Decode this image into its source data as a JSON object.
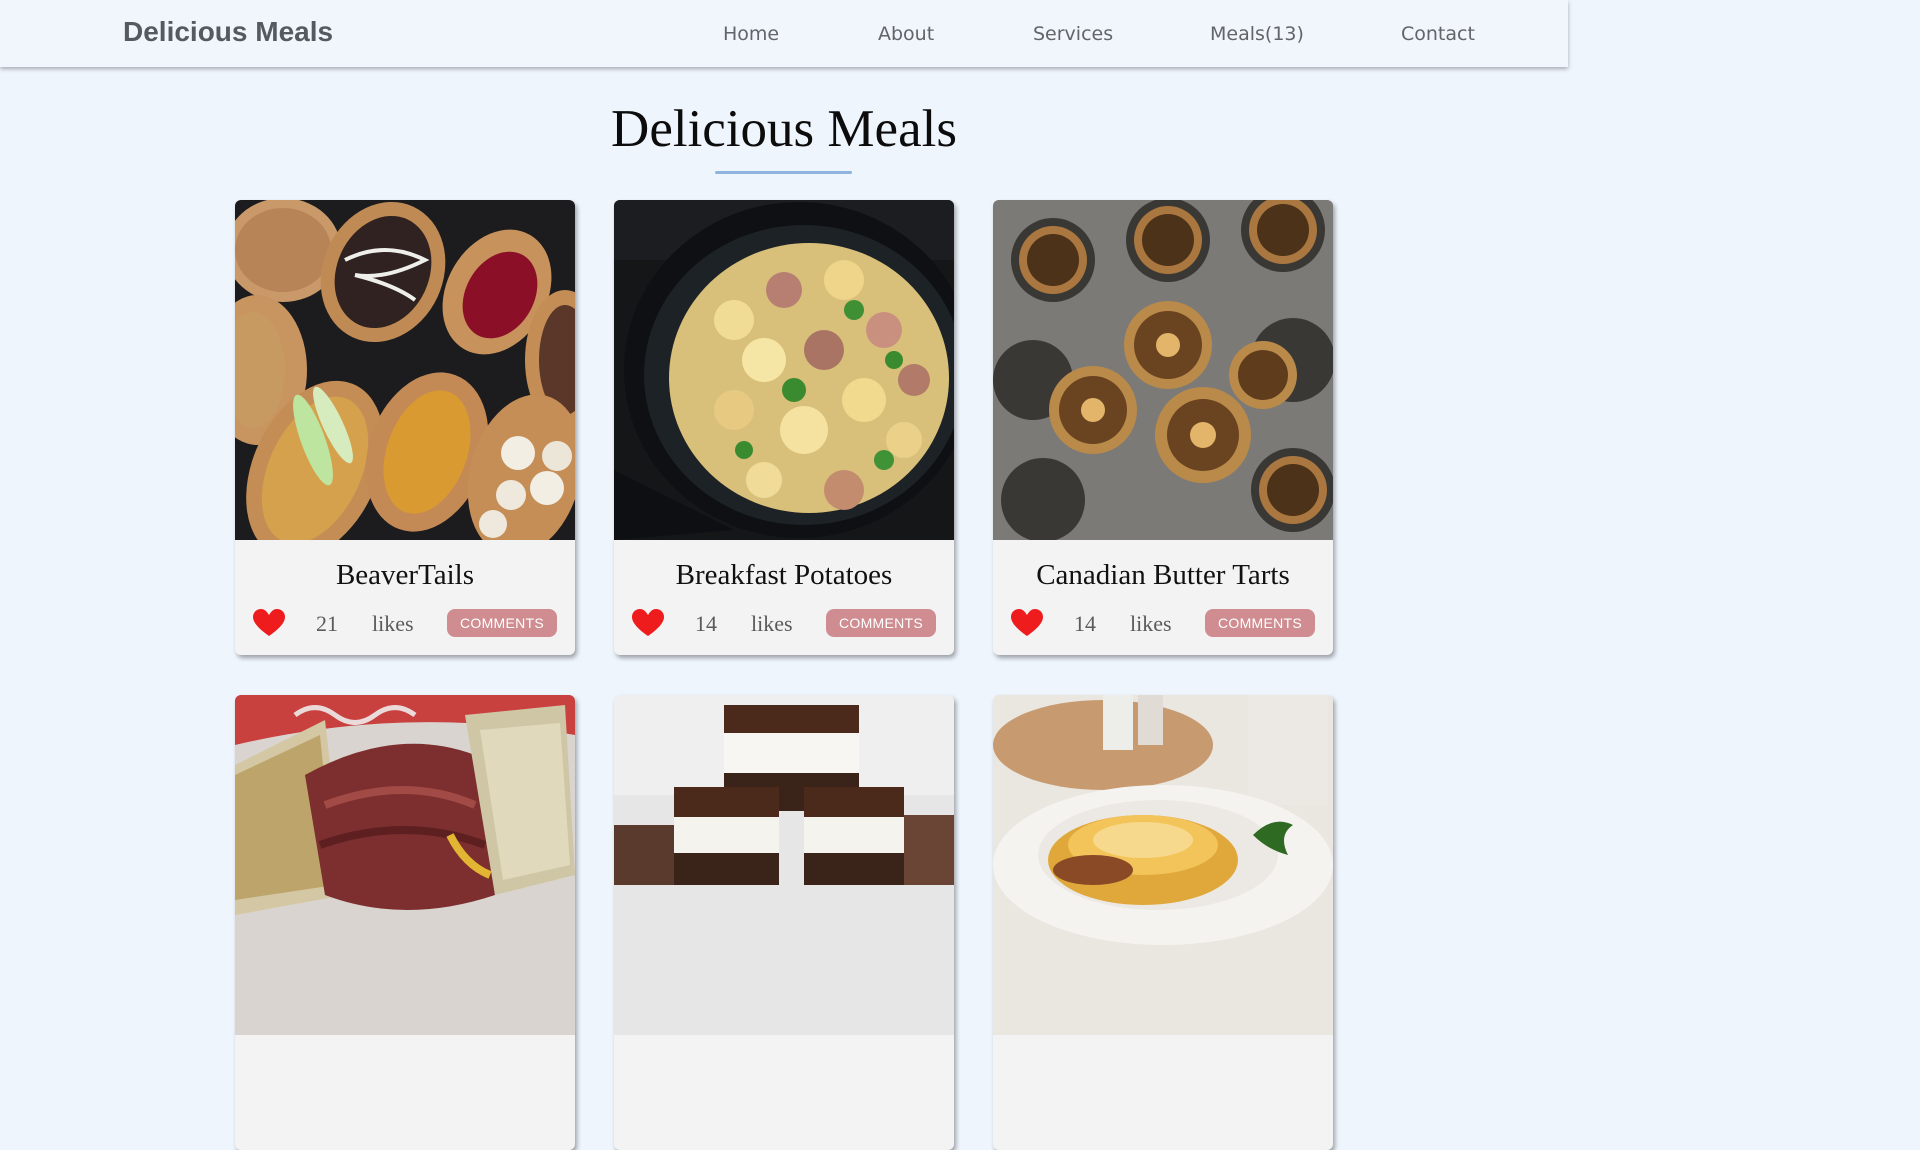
{
  "nav": {
    "brand": "Delicious Meals",
    "links": [
      "Home",
      "About",
      "Services",
      "Meals(13)",
      "Contact"
    ]
  },
  "page": {
    "title": "Delicious Meals"
  },
  "meals": [
    {
      "name": "BeaverTails",
      "likes": "21",
      "likes_label": "likes",
      "comments_label": "COMMENTS"
    },
    {
      "name": "Breakfast Potatoes",
      "likes": "14",
      "likes_label": "likes",
      "comments_label": "COMMENTS"
    },
    {
      "name": "Canadian Butter Tarts",
      "likes": "14",
      "likes_label": "likes",
      "comments_label": "COMMENTS"
    },
    {
      "name": "",
      "likes": "",
      "likes_label": "",
      "comments_label": ""
    },
    {
      "name": "",
      "likes": "",
      "likes_label": "",
      "comments_label": ""
    },
    {
      "name": "",
      "likes": "",
      "likes_label": "",
      "comments_label": ""
    }
  ],
  "colors": {
    "heart": "#ee1c1c",
    "comments_button": "#d08d91",
    "underline": "#8fb4de"
  }
}
